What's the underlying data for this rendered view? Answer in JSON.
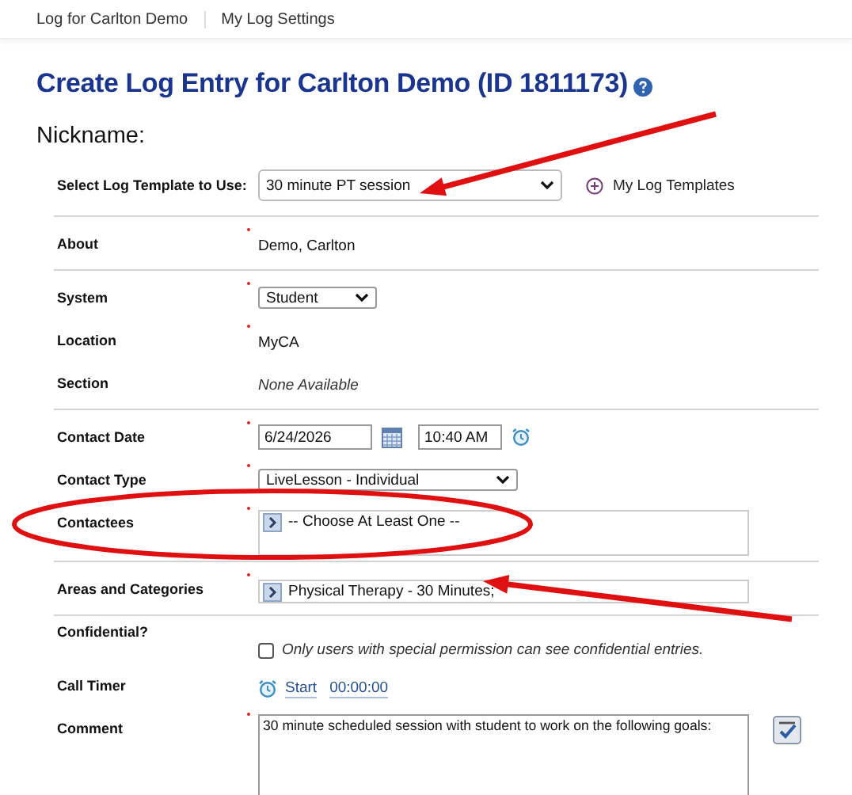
{
  "nav": [
    {
      "label": "Log for Carlton Demo",
      "selected": false
    },
    {
      "label": "My Log Settings",
      "selected": false
    }
  ],
  "title": "Create Log Entry for Carlton Demo (ID 1811173)",
  "nickname_label": "Nickname:",
  "template": {
    "label": "Select Log Template to Use:",
    "value": "30 minute PT session",
    "link": "My Log Templates"
  },
  "sections": [
    {
      "rows": [
        {
          "kind": "text",
          "label": "About",
          "required": true,
          "value": "Demo, Carlton"
        }
      ]
    },
    {
      "rows": [
        {
          "kind": "select",
          "label": "System",
          "required": true,
          "value": "Student"
        },
        {
          "kind": "text",
          "label": "Location",
          "required": true,
          "value": "MyCA"
        },
        {
          "kind": "note",
          "label": "Section",
          "required": false,
          "value": "None Available"
        }
      ]
    },
    {
      "rows": [
        {
          "kind": "datetime",
          "label": "Contact Date",
          "required": true,
          "date": "6/24/2026",
          "time": "10:40 AM"
        },
        {
          "kind": "select",
          "label": "Contact Type",
          "required": true,
          "value": "LiveLesson - Individual"
        },
        {
          "kind": "picker",
          "label": "Contactees",
          "required": true,
          "value": "-- Choose At Least One --",
          "tall": true
        }
      ]
    },
    {
      "rows": [
        {
          "kind": "picker",
          "label": "Areas and Categories",
          "required": true,
          "value": "Physical Therapy - 30 Minutes;",
          "tall": false
        }
      ]
    },
    {
      "rows": [
        {
          "kind": "checkbox",
          "label": "Confidential?",
          "required": false,
          "checked": false,
          "text": "Only users with special permission can see confidential entries."
        },
        {
          "kind": "timer",
          "label": "Call Timer",
          "required": false,
          "action": "Start",
          "elapsed": "00:00:00"
        },
        {
          "kind": "textarea",
          "label": "Comment",
          "required": true,
          "value": "30 minute scheduled session with student to work on the following goals:"
        }
      ]
    }
  ],
  "annotations": [
    {
      "kind": "arrow"
    },
    {
      "kind": "ellipse"
    },
    {
      "kind": "arrow"
    }
  ]
}
